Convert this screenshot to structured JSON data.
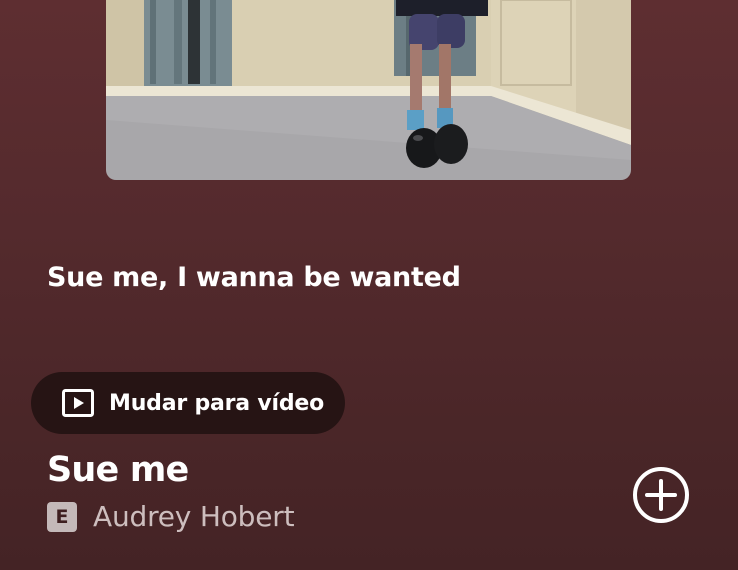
{
  "lyrics": {
    "current_line": "Sue me, I wanna be wanted"
  },
  "video_toggle": {
    "icon": "play-icon",
    "label": "Mudar para vídeo"
  },
  "track": {
    "title": "Sue me",
    "explicit_badge": "E",
    "artist": "Audrey Hobert"
  },
  "actions": {
    "add_icon": "add-circle-icon"
  },
  "colors": {
    "background_top": "#5e2e31",
    "background_bottom": "#442325",
    "toggle_background": "#261414",
    "artist_text": "#cdbebe",
    "badge_background": "#c4b9b9"
  }
}
